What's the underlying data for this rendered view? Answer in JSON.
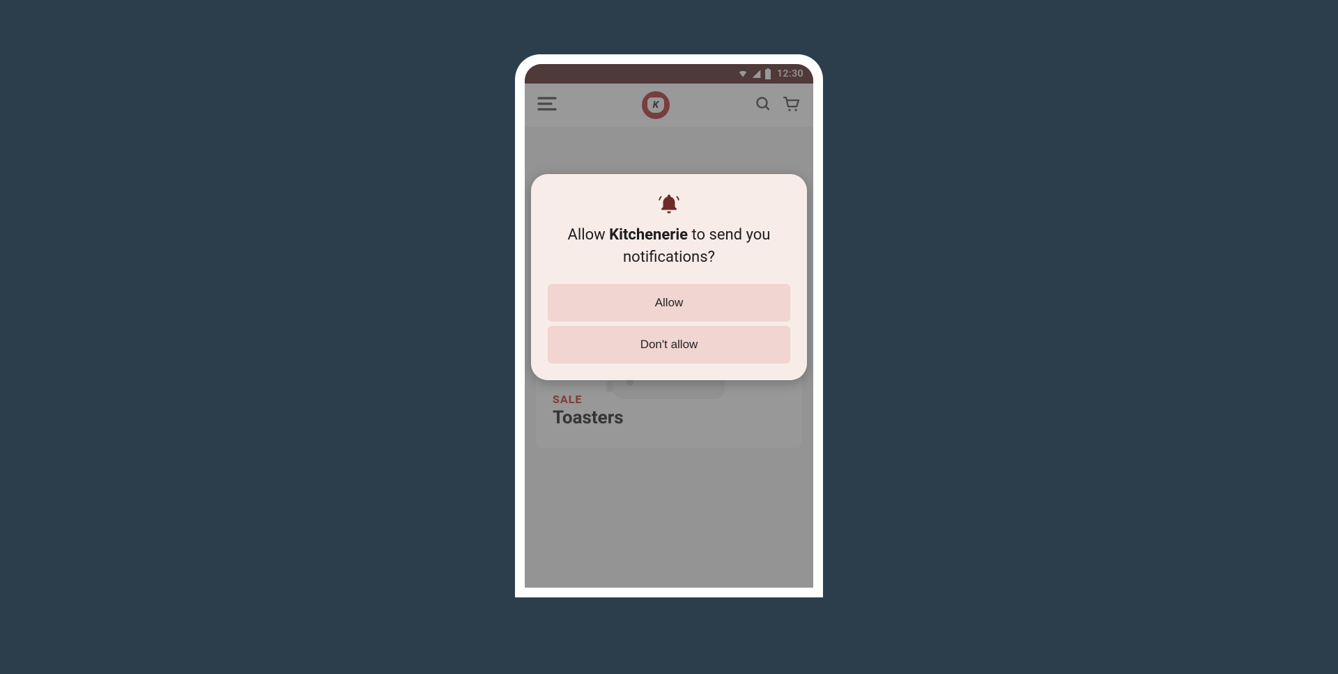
{
  "status_bar": {
    "time": "12:30",
    "icons": {
      "wifi": "wifi-icon",
      "signal": "signal-icon",
      "battery": "battery-icon"
    }
  },
  "app_bar": {
    "menu_icon": "menu-icon",
    "logo_letter": "K",
    "search_icon": "search-icon",
    "cart_icon": "cart-icon"
  },
  "content": {
    "card": {
      "badge": "SALE",
      "title": "Toasters"
    }
  },
  "dialog": {
    "icon": "bell-icon",
    "prompt_prefix": "Allow ",
    "app_name": "Kitchenerie",
    "prompt_suffix": " to send you notifications?",
    "allow_label": "Allow",
    "deny_label": "Don't allow"
  },
  "colors": {
    "background": "#2c3e4c",
    "brand": "#b43535",
    "dialog_bg": "#f7ece8",
    "dialog_button": "#f1d5d0",
    "bell": "#6d2a2a",
    "sale": "#c23a3a"
  }
}
